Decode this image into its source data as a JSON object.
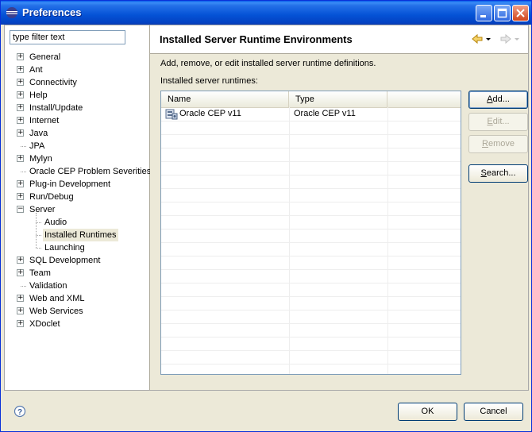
{
  "window": {
    "title": "Preferences"
  },
  "filter": {
    "placeholder": "type filter text"
  },
  "tree": {
    "items": [
      {
        "label": "General",
        "expander": "+"
      },
      {
        "label": "Ant",
        "expander": "+"
      },
      {
        "label": "Connectivity",
        "expander": "+"
      },
      {
        "label": "Help",
        "expander": "+"
      },
      {
        "label": "Install/Update",
        "expander": "+"
      },
      {
        "label": "Internet",
        "expander": "+"
      },
      {
        "label": "Java",
        "expander": "+"
      },
      {
        "label": "JPA",
        "expander": ""
      },
      {
        "label": "Mylyn",
        "expander": "+"
      },
      {
        "label": "Oracle CEP Problem Severities",
        "expander": ""
      },
      {
        "label": "Plug-in Development",
        "expander": "+"
      },
      {
        "label": "Run/Debug",
        "expander": "+"
      },
      {
        "label": "Server",
        "expander": "−"
      },
      {
        "label": "Audio",
        "expander": ""
      },
      {
        "label": "Installed Runtimes",
        "expander": ""
      },
      {
        "label": "Launching",
        "expander": ""
      },
      {
        "label": "SQL Development",
        "expander": "+"
      },
      {
        "label": "Team",
        "expander": "+"
      },
      {
        "label": "Validation",
        "expander": ""
      },
      {
        "label": "Web and XML",
        "expander": "+"
      },
      {
        "label": "Web Services",
        "expander": "+"
      },
      {
        "label": "XDoclet",
        "expander": "+"
      }
    ]
  },
  "page": {
    "title": "Installed Server Runtime Environments",
    "description": "Add, remove, or edit installed server runtime definitions.",
    "table_label": "Installed server runtimes:",
    "columns": [
      "Name",
      "Type"
    ],
    "rows": [
      {
        "name": "Oracle CEP v11",
        "type": "Oracle CEP v11"
      }
    ]
  },
  "buttons": {
    "add_prefix": "",
    "add_mnemonic": "A",
    "add_rest": "dd...",
    "edit_prefix": "",
    "edit_mnemonic": "E",
    "edit_rest": "dit...",
    "remove_prefix": "",
    "remove_mnemonic": "R",
    "remove_rest": "emove",
    "search_prefix": "",
    "search_mnemonic": "S",
    "search_rest": "earch...",
    "ok": "OK",
    "cancel": "Cancel"
  },
  "colors": {
    "title_bar": "#0452d6",
    "dialog_bg": "#ece9d8",
    "accent_border": "#003c74"
  }
}
